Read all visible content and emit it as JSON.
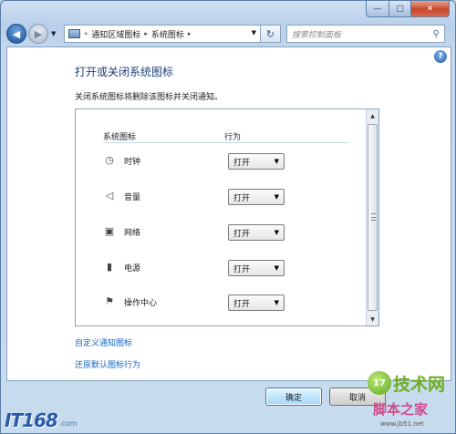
{
  "titlebar": {
    "minimize_glyph": "—",
    "maximize_glyph": "□",
    "close_glyph": "✕"
  },
  "nav": {
    "back_icon": "arrow-left-icon",
    "forward_icon": "arrow-right-icon",
    "address_breadcrumbs": [
      "通知区域图标",
      "系统图标"
    ],
    "address_prefix": "«",
    "separator": "▸",
    "search_placeholder": "搜索控制面板"
  },
  "page": {
    "title": "打开或关闭系统图标",
    "description": "关闭系统图标将删除该图标并关闭通知。",
    "help_glyph": "?"
  },
  "table": {
    "headers": [
      "系统图标",
      "行为"
    ],
    "rows": [
      {
        "name": "时钟",
        "icon": "clock-icon",
        "glyph": "◷",
        "behavior": "打开"
      },
      {
        "name": "音量",
        "icon": "speaker-icon",
        "glyph": "◁",
        "behavior": "打开"
      },
      {
        "name": "网络",
        "icon": "network-icon",
        "glyph": "▣",
        "behavior": "打开"
      },
      {
        "name": "电源",
        "icon": "power-icon",
        "glyph": "▮",
        "behavior": "打开"
      },
      {
        "name": "操作中心",
        "icon": "flag-icon",
        "glyph": "⚑",
        "behavior": "打开"
      }
    ]
  },
  "links": {
    "customize": "自定义通知图标",
    "restore": "还原默认图标行为"
  },
  "buttons": {
    "ok": "确定",
    "cancel": "取消"
  },
  "watermarks": {
    "left_mark": "IT168",
    "left_domain": ".com",
    "right_logo": "17",
    "right_name": "技术网",
    "right_name2": "脚本之家",
    "right_site": "www.jb51.net"
  }
}
